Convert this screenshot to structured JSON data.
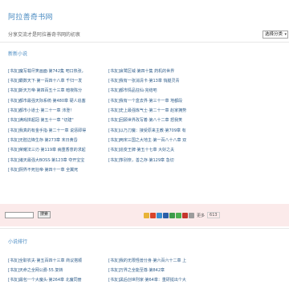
{
  "header": {
    "title": "阿拉善奇书网",
    "subtitle": "分享交流才是阿拉善奇书网的初衷",
    "category_select": "选择分类"
  },
  "latest": {
    "title": "新新小说",
    "rows": [
      [
        "[书友]魔写载尽笑画面·第742集 吧口热张，",
        "[书友]哀鹭区域·第四十集 药机的世界"
      ],
      [
        "[书友]霸数天下·第一百四十八章 千归一发",
        "[书友]我有一张消清卡·第13章 悄腿灵青"
      ],
      [
        "[书友]斯天万帝·第四百五十三章 暗夜陈分",
        "[书友]都市情品狂仙·完结吧"
      ],
      [
        "[书友]都市最强天际系统·第480章 硬人追塞",
        "[书友]我有一个盒去界·第三十一章 地都段"
      ],
      [
        "[书友]都市小道士·第二十一章 沛澄！",
        "[书友]史上最强炼气士·第二十一章 赵家拥势"
      ],
      [
        "[书友]满戏拼超冠·第五十一章 \"切建\"",
        "[书友]回顾世界改写着·第八十二章 怒我笑"
      ],
      [
        "[书友]我真的有金手指·第二十一章 说惩即得",
        "[书友]以乃刀魔：接受原来主教·第709章 有"
      ],
      [
        "[书友]无腔边锋生存·第273章 末日黄昏",
        "[书友]两宋三国之大地主·第一百八十八章 双"
      ],
      [
        "[书友]荣耀法三刃·第119章 病重香意的求起",
        "[书友]追变王牌·第五十七章 大好之夫"
      ],
      [
        "[书友]诸天最强大BOSS·第123章 夺开宝宝",
        "[书友]筝别奈，善之存·第129章 急切"
      ],
      [
        "[书友]阴界不死狂帝·第四十一章 全翼死",
        ""
      ]
    ]
  },
  "search": {
    "button_label": "搜索"
  },
  "share": {
    "label": "更多",
    "count": "613",
    "icons": [
      "qzone-icon",
      "weibo-icon",
      "tencent-weibo-icon",
      "renren-icon",
      "douban-icon",
      "wechat-icon",
      "kaixin-icon",
      "more-share-icon"
    ],
    "colors": [
      "#e8b338",
      "#d9452b",
      "#3a8fd0",
      "#2a5ea8",
      "#3e9b4a",
      "#4caf50",
      "#c4352c",
      "#9c9c9c"
    ]
  },
  "ranking": {
    "title": "小说排行",
    "rows": [
      [
        "[书友]全职农夫·第五百四十三章 商议搭顺",
        "[书友]我的无限怪兽分身·第六百六十二章 上"
      ],
      [
        "[书友]天命之全网公爵·55.复转",
        "[书友]万界之全能至尊·第842章"
      ],
      [
        "[书友]最包一个大魔头·第264章 北魔同册",
        "[书友]黑后创世刑家·第64章：重研挺出个大"
      ]
    ]
  }
}
